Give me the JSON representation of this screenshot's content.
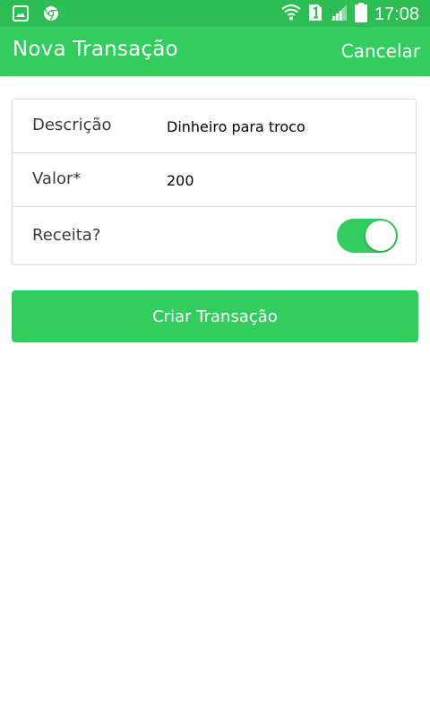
{
  "status_bar": {
    "time": "17:08",
    "notification_icons": [
      "gallery-icon",
      "chrome-icon"
    ],
    "system_icons": [
      "wifi-icon",
      "sim-1-icon",
      "signal-icon",
      "battery-icon"
    ]
  },
  "app_bar": {
    "title": "Nova Transação",
    "action_label": "Cancelar"
  },
  "form": {
    "description": {
      "label": "Descrição",
      "value": "Dinheiro para troco"
    },
    "amount": {
      "label": "Valor*",
      "value": "200"
    },
    "income": {
      "label": "Receita?",
      "checked": true
    }
  },
  "submit_button": {
    "label": "Criar Transação"
  },
  "colors": {
    "accent": "#33cc5f",
    "status_bar": "#2ebd55"
  }
}
